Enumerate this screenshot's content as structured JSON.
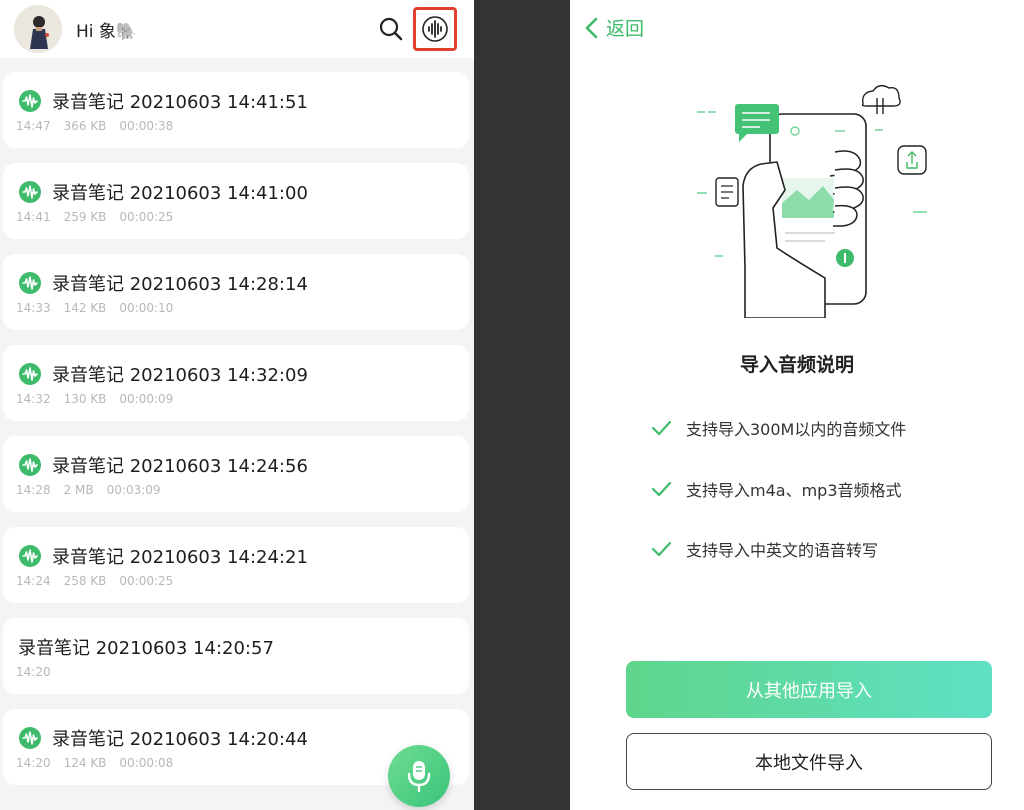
{
  "header": {
    "greeting": "Hi 象🐘"
  },
  "recordings": [
    {
      "title": "录音笔记 20210603 14:41:51",
      "time": "14:47",
      "size": "366 KB",
      "duration": "00:00:38",
      "has_icon": true
    },
    {
      "title": "录音笔记 20210603 14:41:00",
      "time": "14:41",
      "size": "259 KB",
      "duration": "00:00:25",
      "has_icon": true
    },
    {
      "title": "录音笔记 20210603 14:28:14",
      "time": "14:33",
      "size": "142 KB",
      "duration": "00:00:10",
      "has_icon": true
    },
    {
      "title": "录音笔记 20210603 14:32:09",
      "time": "14:32",
      "size": "130 KB",
      "duration": "00:00:09",
      "has_icon": true
    },
    {
      "title": "录音笔记 20210603 14:24:56",
      "time": "14:28",
      "size": "2 MB",
      "duration": "00:03:09",
      "has_icon": true
    },
    {
      "title": "录音笔记 20210603 14:24:21",
      "time": "14:24",
      "size": "258 KB",
      "duration": "00:00:25",
      "has_icon": true
    },
    {
      "title": "录音笔记 20210603 14:20:57",
      "time": "14:20",
      "size": "",
      "duration": "",
      "has_icon": false
    },
    {
      "title": "录音笔记 20210603 14:20:44",
      "time": "14:20",
      "size": "124 KB",
      "duration": "00:00:08",
      "has_icon": true
    }
  ],
  "import_page": {
    "back_label": "返回",
    "title": "导入音频说明",
    "features": [
      "支持导入300M以内的音频文件",
      "支持导入m4a、mp3音频格式",
      "支持导入中英文的语音转写"
    ],
    "primary_button": "从其他应用导入",
    "secondary_button": "本地文件导入"
  },
  "icons": {
    "wave": "audio-wave-icon",
    "search": "search-icon",
    "import": "audio-import-icon",
    "mic": "microphone-icon",
    "back": "chevron-left-icon",
    "check": "checkmark-icon"
  },
  "colors": {
    "accent": "#3dbb6a",
    "highlight_border": "#e0402e",
    "primary_gradient_start": "#5fd58b",
    "primary_gradient_end": "#5fe0c4"
  }
}
